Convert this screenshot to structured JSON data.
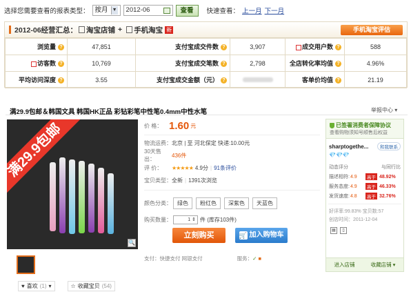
{
  "filter": {
    "prompt": "选择您需要查看的报表类型：",
    "period": "按月",
    "month": "2012-06",
    "view_btn": "查看",
    "quick_label": "快速查看：",
    "prev_month": "上一月",
    "next_month": "下一月"
  },
  "summary": {
    "title_prefix": "2012-06经营汇总：",
    "shop_label": "淘宝店铺",
    "plus": "+",
    "mobile_label": "手机淘宝",
    "new_tag": "新",
    "rate_button": "手机淘宝评估",
    "rows": [
      [
        {
          "label": "浏览量",
          "value": "47,851"
        },
        {
          "label": "支付宝成交件数",
          "value": "3,907"
        },
        {
          "label": "成交用户数",
          "value": "588"
        }
      ],
      [
        {
          "label": "访客数",
          "value": "10,769"
        },
        {
          "label": "支付宝成交笔数",
          "value": "2,798"
        },
        {
          "label": "全店转化率均值",
          "value": "4.96%"
        }
      ],
      [
        {
          "label": "平均访问深度",
          "value": "3.55"
        },
        {
          "label": "支付宝成交金额（元）",
          "value": ""
        },
        {
          "label": "客单价均值",
          "value": "21.19"
        }
      ]
    ]
  },
  "product": {
    "title": "满29.9包邮＆韩国文具  韩国HK正品  彩钻彩笔中性笔0.4mm中性水笔",
    "report": "举报中心",
    "banner": "满29.9包邮",
    "price_label": "价    格：",
    "price": "1.60",
    "price_unit": "元",
    "shipping_label": "物流运费：",
    "shipping": "北京 | 至  河北保定    快递:10.00元",
    "sold_prefix": "30天售出：",
    "sold": "436件",
    "rating_label": "评    价：",
    "stars": "★★★★★",
    "rating": "4.9分",
    "rating_count": "91条评价",
    "type_label": "宝贝类型：",
    "type": "全新",
    "views": "1391次浏览",
    "color_label": "颜色分类：",
    "colors": [
      "绿色",
      "粉红色",
      "深紫色",
      "天蓝色"
    ],
    "qty_label": "购买数量：",
    "qty": "1",
    "stock": "件 (库存103件)",
    "buy": "立刻购买",
    "cart": "加入购物车",
    "pay_label": "支付：",
    "pay": "快捷支付   网银支付",
    "service_label": "服务：",
    "like": "喜欢",
    "like_count": "(1)",
    "fav": "收藏宝贝",
    "fav_count": "(54)",
    "zoom_icon": "magnifier-icon"
  },
  "seller": {
    "guarantee": "已签署消费者保障协议",
    "guarantee_sub": "查看购物须知号顺售后权益",
    "name": "sharptogethe...",
    "ww": "和我联系",
    "diamonds": "💎💎💎",
    "score_head": "动态评分",
    "compare_head": "与同行比",
    "scores": [
      {
        "label": "描述相符:",
        "value": "4.9",
        "tag": "高于",
        "pct": "48.92%"
      },
      {
        "label": "服务态度:",
        "value": "4.9",
        "tag": "高于",
        "pct": "46.33%"
      },
      {
        "label": "发货速度:",
        "value": "4.8",
        "tag": "高于",
        "pct": "32.76%"
      }
    ],
    "rate": "好评率:99.83%  宝贝数:57",
    "created": "创店时间：2011-12-04",
    "enter_shop": "进入店铺",
    "fav_shop": "收藏店铺"
  }
}
